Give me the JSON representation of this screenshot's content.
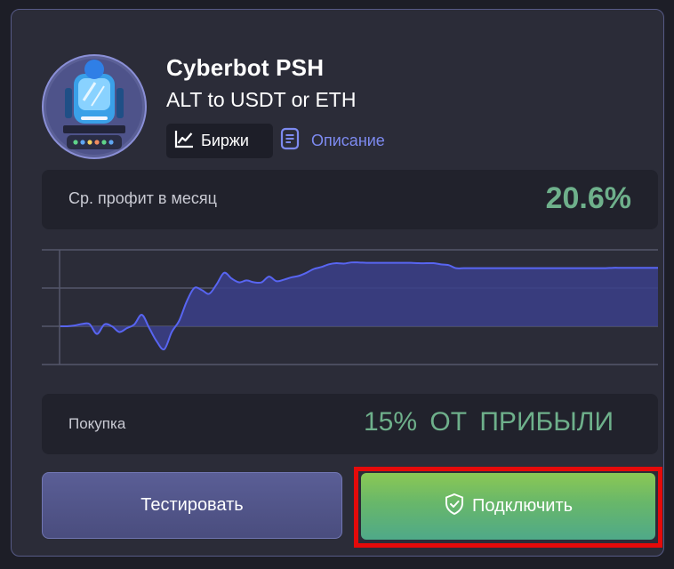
{
  "bot": {
    "title": "Cyberbot PSH",
    "subtitle": "ALT to USDT or ETH",
    "avatar_icon": "robot-icon"
  },
  "tabs": {
    "exchanges_label": "Биржи",
    "exchanges_icon": "line-chart-icon",
    "description_label": "Описание",
    "description_icon": "document-icon"
  },
  "profit": {
    "label": "Ср. профит в месяц",
    "value": "20.6%"
  },
  "purchase": {
    "label": "Покупка",
    "value": "15% ОТ ПРИБЫЛИ"
  },
  "buttons": {
    "test_label": "Тестировать",
    "connect_label": "Подключить",
    "connect_icon": "shield-check-icon"
  },
  "colors": {
    "card_bg": "#2b2c38",
    "accent_green": "#6eb08b",
    "chart_line": "#5865f2",
    "chart_fill": "#3b3f8a",
    "link_blue": "#7d8af0",
    "highlight_red": "#e50a0a"
  },
  "chart_data": {
    "type": "area",
    "title": "",
    "xlabel": "",
    "ylabel": "",
    "grid": true,
    "ylim": [
      -1,
      2
    ],
    "x": [
      0,
      1,
      2,
      3,
      4,
      5,
      6,
      7,
      8,
      9,
      10,
      11,
      12,
      13,
      14,
      15,
      16,
      17,
      18,
      19,
      20,
      21,
      22,
      23,
      24,
      25,
      26,
      27,
      28,
      29,
      30,
      31,
      32,
      33,
      34,
      35,
      36,
      37,
      38,
      39,
      40,
      41,
      42,
      43,
      44,
      45,
      46,
      47,
      48,
      49,
      50,
      51,
      52,
      53,
      54,
      55,
      56,
      57,
      58,
      59,
      60,
      61,
      62,
      63,
      64,
      65,
      66,
      67,
      68,
      69,
      70,
      71,
      72,
      73,
      74,
      75,
      76,
      77,
      78,
      79,
      80
    ],
    "series": [
      {
        "values": [
          0.0,
          0.0,
          0.02,
          0.06,
          0.06,
          -0.2,
          0.05,
          0.0,
          -0.15,
          -0.05,
          0.05,
          0.3,
          -0.05,
          -0.4,
          -0.6,
          -0.15,
          0.15,
          0.65,
          1.0,
          0.95,
          0.85,
          1.1,
          1.4,
          1.25,
          1.15,
          1.2,
          1.15,
          1.15,
          1.3,
          1.18,
          1.22,
          1.28,
          1.32,
          1.4,
          1.5,
          1.55,
          1.62,
          1.65,
          1.64,
          1.67,
          1.67,
          1.66,
          1.66,
          1.66,
          1.66,
          1.66,
          1.66,
          1.66,
          1.65,
          1.65,
          1.65,
          1.62,
          1.6,
          1.52,
          1.52,
          1.52,
          1.52,
          1.52,
          1.52,
          1.52,
          1.52,
          1.52,
          1.52,
          1.52,
          1.52,
          1.52,
          1.52,
          1.52,
          1.52,
          1.52,
          1.52,
          1.52,
          1.52,
          1.52,
          1.53,
          1.53,
          1.53,
          1.53,
          1.53,
          1.53,
          1.53
        ]
      }
    ]
  }
}
